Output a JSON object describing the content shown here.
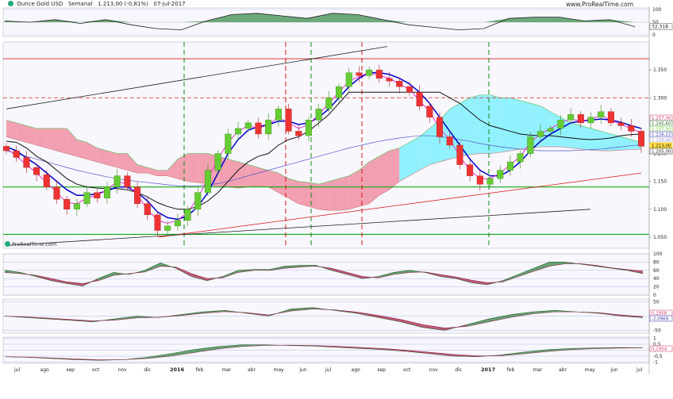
{
  "header": {
    "instrument": "Ounce Gold USD",
    "timeframe": "Semanal",
    "quote": "1.213,00 (-0,81%)",
    "date": "07-jul-2017"
  },
  "brand": "www.ProRealTime.com",
  "brand_small": "ProRealTime.com",
  "colors": {
    "up": "#66cc33",
    "down": "#ee3333",
    "cloud_bull": "#66eeff",
    "cloud_bear": "#f07a90",
    "osc_bull": "#3f8f4f",
    "osc_bear": "#b8305a",
    "ma_fast": "#ee22cc",
    "ma_mid": "#0000cc",
    "ma_slow": "#111111",
    "ma_long": "#5555cc"
  },
  "chart_data": [
    {
      "type": "line",
      "panel": "top-oscillator",
      "y_ticks": [
        "100",
        "50",
        "0"
      ],
      "last_value_label": "32,318",
      "x": [
        "2015-06",
        "2015-07",
        "2015-08",
        "2015-09",
        "2015-10",
        "2015-11",
        "2015-12",
        "2016-01",
        "2016-02",
        "2016-03",
        "2016-04",
        "2016-05",
        "2016-06",
        "2016-07",
        "2016-08",
        "2016-09",
        "2016-10",
        "2016-11",
        "2016-12",
        "2017-01",
        "2017-02",
        "2017-03",
        "2017-04",
        "2017-05",
        "2017-06",
        "2017-07"
      ],
      "values": [
        55,
        50,
        60,
        45,
        60,
        40,
        25,
        20,
        55,
        80,
        85,
        75,
        65,
        85,
        80,
        60,
        40,
        30,
        20,
        25,
        65,
        70,
        70,
        55,
        60,
        32.318
      ]
    },
    {
      "type": "candlestick",
      "panel": "price",
      "title": "Ounce Gold USD",
      "ylim": [
        1030,
        1400
      ],
      "y_ticks": [
        "1.350",
        "1.300",
        "1.250",
        "1.200",
        "1.150",
        "1.100",
        "1.050"
      ],
      "price_labels": [
        "1.257,00",
        "1.245,60",
        "1.237,00",
        "1.226,22",
        "1.220,00",
        "1.213,00",
        "1.205,00"
      ],
      "x_ticks": [
        "jul",
        "ago",
        "sep",
        "oct",
        "nov",
        "dic",
        "2016",
        "feb",
        "mar",
        "abr",
        "may",
        "jun",
        "jul",
        "ago",
        "sep",
        "oct",
        "nov",
        "dic",
        "2017",
        "feb",
        "mar",
        "abr",
        "may",
        "jun",
        "jul"
      ],
      "close": [
        1205,
        1193,
        1175,
        1162,
        1140,
        1118,
        1100,
        1110,
        1130,
        1120,
        1140,
        1160,
        1140,
        1110,
        1090,
        1062,
        1070,
        1080,
        1100,
        1130,
        1170,
        1200,
        1235,
        1245,
        1255,
        1235,
        1260,
        1280,
        1240,
        1232,
        1260,
        1280,
        1300,
        1320,
        1345,
        1340,
        1350,
        1335,
        1330,
        1320,
        1310,
        1285,
        1265,
        1230,
        1215,
        1180,
        1160,
        1145,
        1155,
        1170,
        1185,
        1200,
        1230,
        1240,
        1245,
        1260,
        1270,
        1255,
        1265,
        1275,
        1255,
        1250,
        1240,
        1213
      ],
      "ma_fast": [
        1210,
        1195,
        1180,
        1165,
        1148,
        1130,
        1112,
        1110,
        1120,
        1125,
        1135,
        1150,
        1145,
        1125,
        1100,
        1080,
        1075,
        1080,
        1095,
        1120,
        1155,
        1190,
        1220,
        1240,
        1250,
        1245,
        1252,
        1265,
        1255,
        1245,
        1252,
        1270,
        1290,
        1310,
        1330,
        1338,
        1345,
        1340,
        1335,
        1325,
        1315,
        1295,
        1275,
        1245,
        1225,
        1195,
        1170,
        1155,
        1155,
        1165,
        1180,
        1195,
        1220,
        1235,
        1245,
        1255,
        1262,
        1258,
        1262,
        1268,
        1260,
        1252,
        1245,
        1237
      ],
      "ma_mid": [
        1212,
        1205,
        1192,
        1180,
        1165,
        1150,
        1135,
        1125,
        1125,
        1128,
        1133,
        1140,
        1140,
        1130,
        1115,
        1095,
        1085,
        1082,
        1088,
        1105,
        1130,
        1165,
        1200,
        1225,
        1242,
        1248,
        1252,
        1258,
        1258,
        1252,
        1255,
        1265,
        1280,
        1300,
        1320,
        1335,
        1345,
        1345,
        1342,
        1335,
        1325,
        1310,
        1290,
        1265,
        1240,
        1215,
        1190,
        1170,
        1160,
        1160,
        1170,
        1185,
        1205,
        1222,
        1235,
        1245,
        1255,
        1258,
        1260,
        1262,
        1260,
        1256,
        1250,
        1245
      ],
      "ma_slow": [
        1222,
        1220,
        1210,
        1195,
        1185,
        1170,
        1155,
        1145,
        1140,
        1138,
        1137,
        1137,
        1135,
        1130,
        1122,
        1112,
        1105,
        1100,
        1100,
        1105,
        1115,
        1130,
        1150,
        1170,
        1185,
        1195,
        1200,
        1215,
        1225,
        1230,
        1240,
        1255,
        1270,
        1290,
        1310,
        1310,
        1310,
        1310,
        1310,
        1310,
        1310,
        1310,
        1310,
        1310,
        1300,
        1290,
        1275,
        1260,
        1250,
        1245,
        1240,
        1235,
        1233,
        1232,
        1232,
        1230,
        1228,
        1226,
        1225,
        1226,
        1228,
        1232,
        1234,
        1235
      ],
      "ma_long": [
        1205,
        1200,
        1195,
        1190,
        1185,
        1180,
        1175,
        1170,
        1166,
        1162,
        1158,
        1155,
        1152,
        1150,
        1148,
        1146,
        1144,
        1142,
        1142,
        1142,
        1144,
        1146,
        1150,
        1155,
        1160,
        1165,
        1170,
        1175,
        1180,
        1185,
        1190,
        1195,
        1200,
        1205,
        1210,
        1214,
        1218,
        1222,
        1225,
        1228,
        1230,
        1232,
        1232,
        1230,
        1228,
        1225,
        1222,
        1218,
        1215,
        1212,
        1210,
        1208,
        1206,
        1205,
        1205,
        1205,
        1205,
        1206,
        1207,
        1208,
        1210,
        1212,
        1214,
        1216
      ],
      "cloud_top": [
        1260,
        1255,
        1250,
        1245,
        1245,
        1245,
        1245,
        1225,
        1220,
        1210,
        1205,
        1200,
        1200,
        1180,
        1175,
        1170,
        1170,
        1190,
        1200,
        1200,
        1200,
        1195,
        1190,
        1185,
        1180,
        1175,
        1170,
        1165,
        1155,
        1150,
        1148,
        1145,
        1150,
        1155,
        1160,
        1170,
        1185,
        1195,
        1205,
        1210,
        1220,
        1230,
        1245,
        1260,
        1280,
        1290,
        1300,
        1305,
        1305,
        1300,
        1300,
        1295,
        1290,
        1285,
        1275,
        1265,
        1255,
        1250,
        1245,
        1240,
        1235,
        1230,
        1225,
        1220
      ],
      "cloud_bottom": [
        1230,
        1225,
        1220,
        1215,
        1210,
        1205,
        1200,
        1195,
        1190,
        1185,
        1180,
        1175,
        1170,
        1165,
        1165,
        1160,
        1160,
        1155,
        1150,
        1148,
        1145,
        1140,
        1140,
        1138,
        1140,
        1142,
        1140,
        1130,
        1120,
        1110,
        1105,
        1100,
        1098,
        1098,
        1100,
        1105,
        1110,
        1125,
        1135,
        1150,
        1160,
        1170,
        1180,
        1185,
        1190,
        1195,
        1198,
        1200,
        1200,
        1202,
        1205,
        1208,
        1210,
        1212,
        1212,
        1212,
        1210,
        1208,
        1206,
        1205,
        1205,
        1206,
        1207,
        1208
      ],
      "horizontal_levels": [
        1370,
        1300,
        1140,
        1055
      ],
      "vertical_markers": [
        {
          "label": "2016-01",
          "color": "green"
        },
        {
          "label": "2016-05",
          "color": "red"
        },
        {
          "label": "2016-06",
          "color": "green"
        },
        {
          "label": "2016-08",
          "color": "red"
        },
        {
          "label": "2017-01",
          "color": "green"
        }
      ],
      "trendlines": [
        {
          "from": [
            "2015-06",
            1280
          ],
          "to": [
            "2016-09",
            1392
          ],
          "color": "black"
        },
        {
          "from": [
            "2015-12",
            1050
          ],
          "to": [
            "2017-07",
            1165
          ],
          "color": "red"
        },
        {
          "from": [
            "2015-06",
            1035
          ],
          "to": [
            "2017-05",
            1100
          ],
          "color": "black"
        }
      ]
    },
    {
      "type": "area",
      "panel": "oscillator-1",
      "y_ticks": [
        "100",
        "80",
        "60",
        "40",
        "20",
        "0"
      ],
      "series_a": [
        60,
        55,
        45,
        35,
        28,
        22,
        40,
        55,
        50,
        60,
        78,
        65,
        45,
        35,
        45,
        60,
        62,
        62,
        70,
        72,
        72,
        60,
        50,
        40,
        45,
        55,
        60,
        55,
        45,
        40,
        30,
        25,
        35,
        50,
        65,
        80,
        80,
        75,
        70,
        65,
        60,
        52
      ],
      "series_b": [
        55,
        52,
        48,
        40,
        32,
        28,
        35,
        48,
        52,
        56,
        70,
        68,
        52,
        40,
        42,
        55,
        60,
        60,
        65,
        68,
        70,
        65,
        55,
        45,
        42,
        50,
        55,
        56,
        50,
        44,
        36,
        30,
        32,
        45,
        58,
        70,
        76,
        76,
        72,
        66,
        62,
        58
      ]
    },
    {
      "type": "area",
      "panel": "oscillator-2",
      "y_ticks": [
        "50",
        "0",
        "-50"
      ],
      "value_labels": [
        "0,1958",
        "-2,0969"
      ],
      "series_a": [
        0,
        -5,
        -10,
        -15,
        -20,
        -10,
        0,
        -5,
        5,
        15,
        20,
        10,
        0,
        25,
        30,
        20,
        10,
        -5,
        -20,
        -40,
        -50,
        -30,
        -10,
        5,
        15,
        20,
        15,
        10,
        0,
        -5
      ],
      "series_b": [
        0,
        -3,
        -7,
        -12,
        -17,
        -14,
        -6,
        -4,
        2,
        10,
        16,
        12,
        4,
        18,
        25,
        22,
        14,
        2,
        -12,
        -30,
        -42,
        -36,
        -20,
        -4,
        8,
        15,
        15,
        12,
        4,
        -2
      ]
    },
    {
      "type": "area",
      "panel": "oscillator-3",
      "y_ticks": [
        "1",
        "0,5",
        "0",
        "-0,5",
        "-1"
      ],
      "value_labels": [
        "0,1954"
      ],
      "series_a": [
        -0.55,
        -0.6,
        -0.7,
        -0.8,
        -0.85,
        -0.8,
        -0.6,
        -0.3,
        0.05,
        0.3,
        0.45,
        0.45,
        0.4,
        0.35,
        0.25,
        0.15,
        0.05,
        -0.1,
        -0.3,
        -0.5,
        -0.55,
        -0.4,
        -0.15,
        0.05,
        0.15,
        0.2,
        0.22,
        0.2
      ],
      "series_b": [
        -0.55,
        -0.58,
        -0.65,
        -0.74,
        -0.8,
        -0.8,
        -0.7,
        -0.5,
        -0.2,
        0.1,
        0.3,
        0.4,
        0.42,
        0.4,
        0.33,
        0.24,
        0.14,
        0,
        -0.18,
        -0.36,
        -0.48,
        -0.46,
        -0.3,
        -0.1,
        0.05,
        0.14,
        0.18,
        0.2
      ]
    }
  ]
}
